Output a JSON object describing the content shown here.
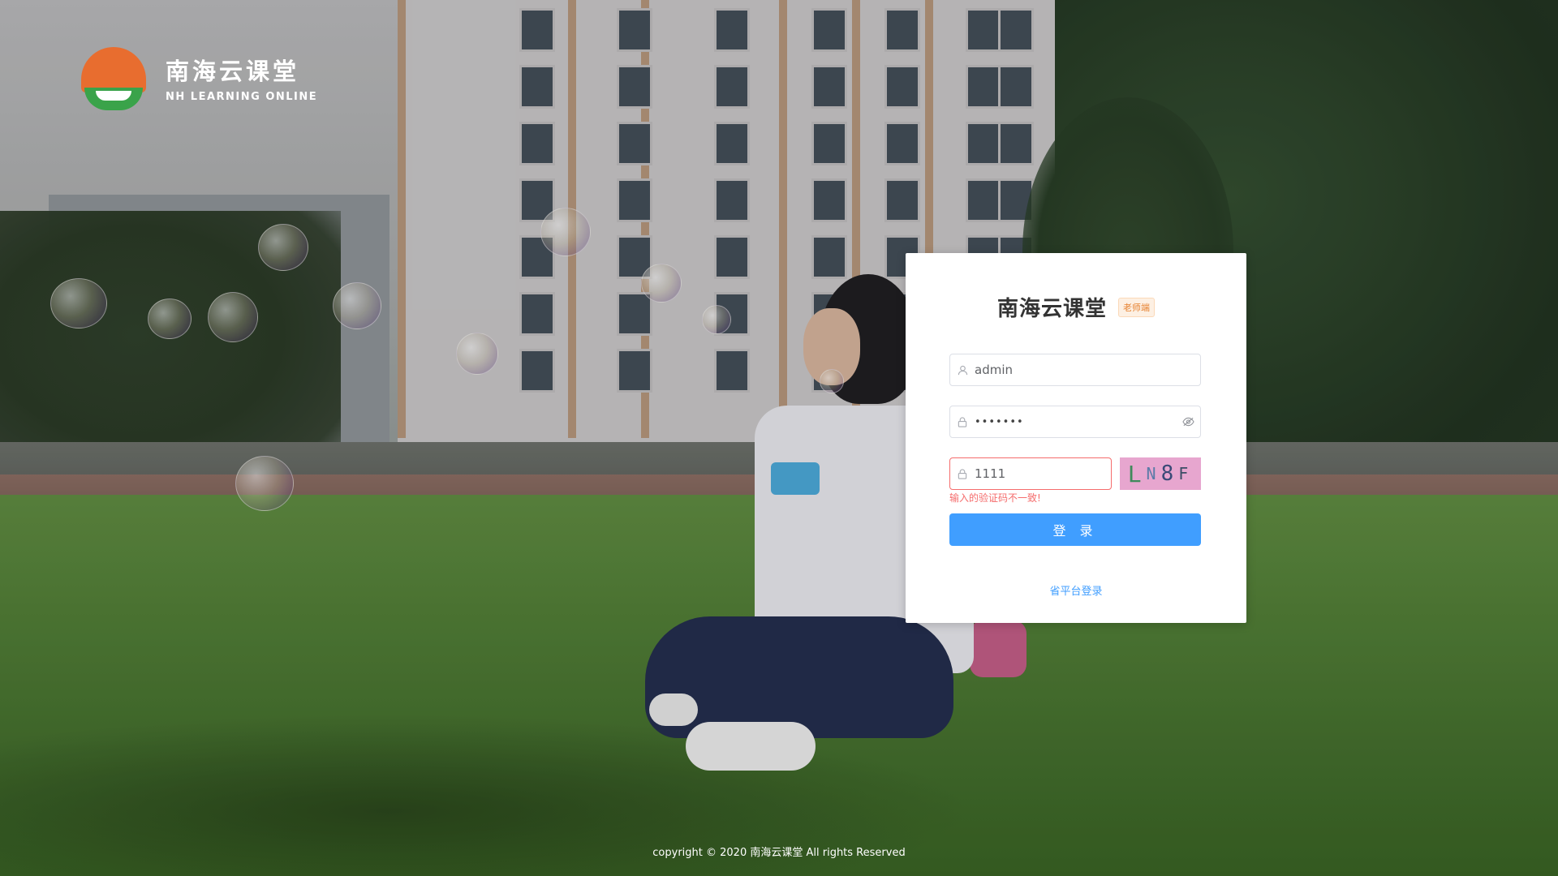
{
  "brand": {
    "name_cn": "南海云课堂",
    "name_en": "NH LEARNING ONLINE"
  },
  "login": {
    "title": "南海云课堂",
    "role_badge": "老师端",
    "username_value": "admin",
    "password_value": "•••••••",
    "captcha_value": "1111",
    "captcha_chars": [
      "L",
      "N",
      "8",
      "F"
    ],
    "captcha_error": "输入的验证码不一致!",
    "submit_label": "登 录",
    "alt_login_link": "省平台登录"
  },
  "footer": {
    "copyright": "copyright © 2020 南海云课堂 All rights Reserved"
  },
  "colors": {
    "primary": "#409eff",
    "error": "#f56c6c",
    "badge": "#e6812f",
    "logo_orange": "#e86d2f",
    "logo_green": "#3aa34a"
  },
  "icons": {
    "username": "user-icon",
    "password": "lock-icon",
    "captcha": "lock-icon",
    "toggle_password": "eye-off-icon"
  }
}
